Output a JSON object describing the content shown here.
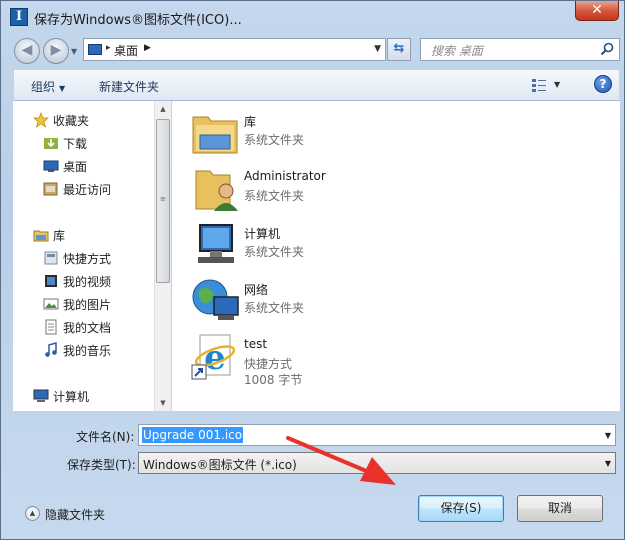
{
  "window": {
    "title": "保存为Windows®图标文件(ICO)...",
    "app_icon_letter": "I",
    "close_label": "✕"
  },
  "address": {
    "location": "桌面",
    "search_placeholder": "搜索 桌面"
  },
  "toolbar": {
    "organize": "组织",
    "new_folder": "新建文件夹",
    "help": "?"
  },
  "sidebar": {
    "favorites": "收藏夹",
    "favorites_items": [
      "下载",
      "桌面",
      "最近访问"
    ],
    "library": "库",
    "library_items": [
      "快捷方式",
      "我的视频",
      "我的图片",
      "我的文档",
      "我的音乐"
    ],
    "computer": "计算机"
  },
  "files": [
    {
      "name": "库",
      "type": "系统文件夹",
      "icon": "library-folder-icon"
    },
    {
      "name": "Administrator",
      "type": "系统文件夹",
      "icon": "user-folder-icon"
    },
    {
      "name": "计算机",
      "type": "系统文件夹",
      "icon": "computer-icon"
    },
    {
      "name": "网络",
      "type": "系统文件夹",
      "icon": "network-icon"
    },
    {
      "name": "test",
      "type": "快捷方式",
      "size": "1008 字节",
      "icon": "ie-shortcut-icon"
    }
  ],
  "form": {
    "filename_label": "文件名(N):",
    "filename_value": "Upgrade 001.ico",
    "filetype_label": "保存类型(T):",
    "filetype_value": "Windows®图标文件 (*.ico)",
    "hide_folders": "隐藏文件夹",
    "save_button": "保存(S)",
    "cancel_button": "取消"
  },
  "colors": {
    "selection": "#3399ff",
    "arrow": "#e8322b",
    "window_frame": "#b9cfe7"
  }
}
